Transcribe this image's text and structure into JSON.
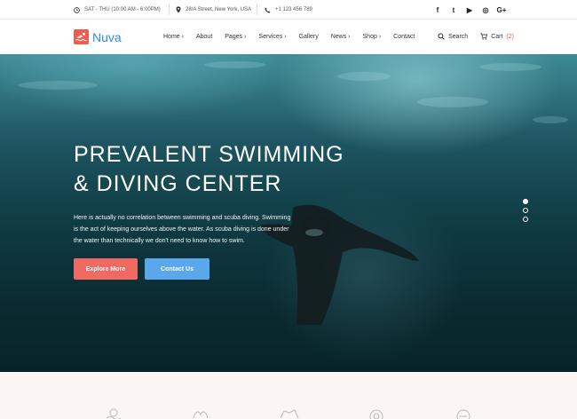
{
  "topbar": {
    "hours": "SAT - THU (10:00 AM - 6:00PM)",
    "address": "28/A Street, New York, USA",
    "phone": "+1 123 456 789",
    "social_icons": [
      "facebook-icon",
      "twitter-icon",
      "youtube-icon",
      "instagram-icon",
      "google-plus-icon"
    ],
    "social_glyphs": [
      "f",
      "t",
      "▶",
      "◎",
      "G+"
    ]
  },
  "brand": {
    "name": "Nuva",
    "accent": "#f05a4f",
    "brand_color": "#2b8fe0"
  },
  "nav": {
    "items": [
      "Home",
      "About",
      "Pages",
      "Services",
      "Gallery",
      "News",
      "Shop",
      "Contact"
    ],
    "search_label": "Search",
    "cart_label": "Cart",
    "cart_count": "(2)"
  },
  "hero": {
    "title_line1": "PREVALENT SWIMMING",
    "title_line2": "& DIVING CENTER",
    "text": "Here is actually no correlation between swimming and scuba diving. Swimming is the act of keeping ourselves above the water. As scuba diving is done under the water than technically we don't need to know how to swim.",
    "explore_label": "Explore More",
    "contact_label": "Contact Us",
    "explore_color": "#f06a62",
    "contact_color": "#5aa7ec",
    "slides": 3,
    "active_slide": 1
  }
}
